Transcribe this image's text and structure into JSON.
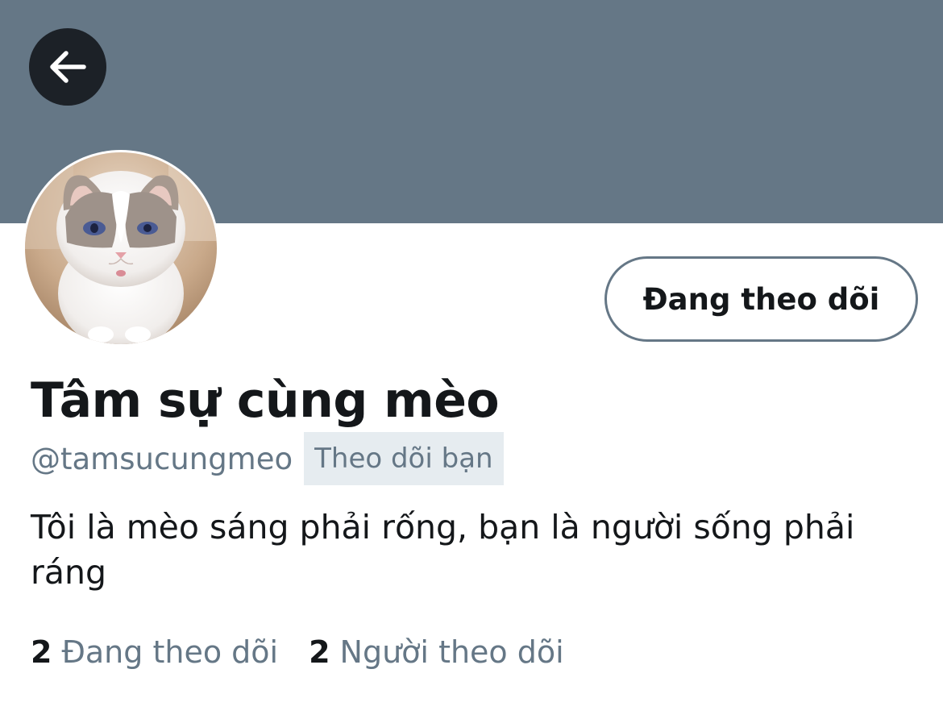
{
  "colors": {
    "banner": "#657786",
    "back_button_bg": "#1c2127",
    "primary_text": "#14171a",
    "secondary_text": "#657786",
    "badge_bg": "#e6ecf0"
  },
  "header": {
    "back_icon": "arrow-left-icon"
  },
  "profile": {
    "avatar_alt": "cat-avatar",
    "follow_button_label": "Đang theo dõi",
    "display_name": "Tâm sự cùng mèo",
    "handle": "@tamsucungmeo",
    "follows_you_badge": "Theo dõi bạn",
    "bio": "Tôi là mèo sáng phải rống, bạn là người sống phải ráng",
    "stats": [
      {
        "count": "2",
        "label": "Đang theo dõi"
      },
      {
        "count": "2",
        "label": "Người theo dõi"
      }
    ]
  }
}
